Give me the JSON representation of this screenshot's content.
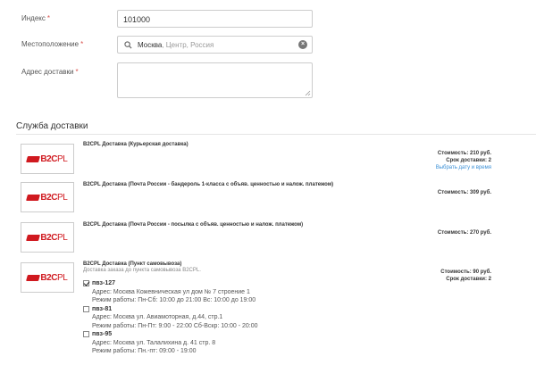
{
  "form": {
    "index": {
      "label": "Индекс",
      "required_mark": "*",
      "value": "101000"
    },
    "location": {
      "label": "Местоположение",
      "required_mark": "*",
      "city": "Москва",
      "hint": ", Центр, Россия"
    },
    "address": {
      "label": "Адрес доставки",
      "required_mark": "*",
      "value": ""
    }
  },
  "delivery": {
    "section_title": "Служба доставки",
    "logo": {
      "b2c": "B2C",
      "pl": "PL"
    },
    "services": [
      {
        "title": "B2CPL Доставка (Курьерская доставка)",
        "cost": "Стоимость: 210 руб.",
        "term": "Срок доставки: 2",
        "link": "Выбрать дату и время"
      },
      {
        "title": "B2CPL Доставка (Почта России - бандероль 1-класса с объяв. ценностью и налож. платежом)",
        "cost": "Стоимость: 309 руб."
      },
      {
        "title": "B2CPL Доставка (Почта России - посылка с объяв. ценностью и налож. платежом)",
        "cost": "Стоимость: 270 руб."
      },
      {
        "title": "B2CPL Доставка (Пункт самовывоза)",
        "desc": "Доставка заказа до пункта самовывоза B2CPL.",
        "cost": "Стоимость: 90 руб.",
        "term": "Срок доставки: 2",
        "points": [
          {
            "name": "пвз-127",
            "checked": true,
            "address": "Адрес: Москва Кожевническая ул дом № 7 строение 1",
            "hours": "Режим работы: Пн-Сб: 10:00 до 21:00 Вс: 10:00 до 19:00"
          },
          {
            "name": "пвз-81",
            "checked": false,
            "address": "Адрес: Москва ул. Авиамоторная, д.44, стр.1",
            "hours": "Режим работы: Пн-Пт: 9:00 - 22:00 Сб-Вскр: 10:00 - 20:00"
          },
          {
            "name": "пвз-95",
            "checked": false,
            "address": "Адрес: Москва ул. Талалихина д. 41 стр. 8",
            "hours": "Режим работы: Пн.-пт: 09:00 - 19:00"
          }
        ]
      }
    ]
  }
}
